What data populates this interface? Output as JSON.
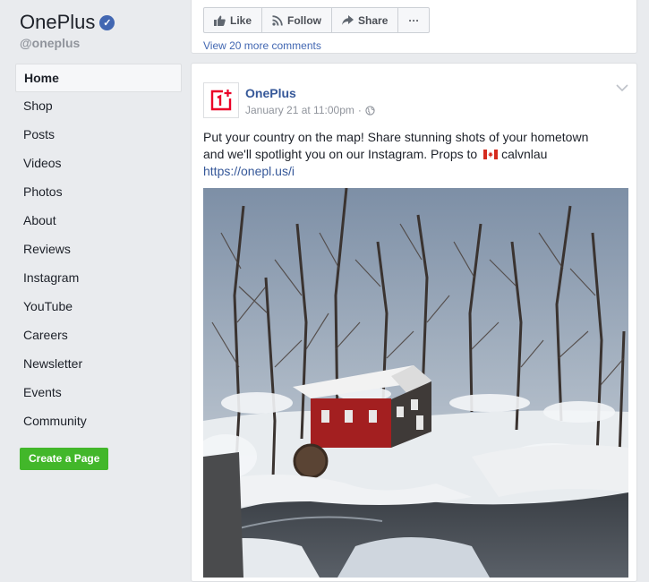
{
  "page": {
    "name": "OnePlus",
    "handle": "@oneplus",
    "verified_mark": "✓"
  },
  "sidebar": {
    "items": [
      {
        "label": "Home"
      },
      {
        "label": "Shop"
      },
      {
        "label": "Posts"
      },
      {
        "label": "Videos"
      },
      {
        "label": "Photos"
      },
      {
        "label": "About"
      },
      {
        "label": "Reviews"
      },
      {
        "label": "Instagram"
      },
      {
        "label": "YouTube"
      },
      {
        "label": "Careers"
      },
      {
        "label": "Newsletter"
      },
      {
        "label": "Events"
      },
      {
        "label": "Community"
      }
    ],
    "active_index": 0,
    "create_page_label": "Create a Page"
  },
  "top_card": {
    "like_label": "Like",
    "follow_label": "Follow",
    "share_label": "Share",
    "more_label": "···",
    "view_more_comments": "View 20 more comments"
  },
  "post": {
    "author": "OnePlus",
    "timestamp": "January 21 at 11:00pm",
    "separator": "·",
    "text_line1": "Put your country on the map! Share stunning shots of your hometown",
    "text_line2a": "and we'll spotlight you on our Instagram. Props to",
    "text_user": "calvnlau",
    "link": "https://onepl.us/i"
  },
  "colors": {
    "brand_red": "#eb0028",
    "link_blue": "#365899",
    "create_green": "#42b72a",
    "verified_blue": "#4267b2"
  },
  "icons": {
    "like": "thumbs-up-icon",
    "follow": "rss-icon",
    "share": "share-arrow-icon",
    "privacy": "globe-icon",
    "menu": "chevron-down-icon",
    "flag": "canada-flag-icon"
  }
}
